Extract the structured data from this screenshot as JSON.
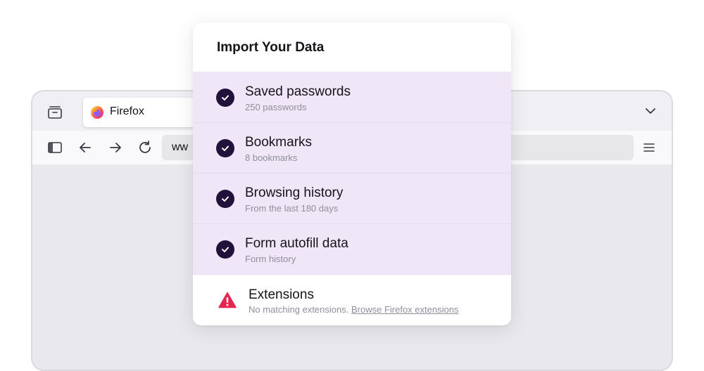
{
  "browser": {
    "tab_title": "Firefox",
    "url_text": "ww",
    "icons": {
      "tab_list": "tab-list-icon",
      "favicon": "firefox-logo-icon",
      "tabs_menu": "chevron-down-icon",
      "sidebar": "sidebar-icon",
      "back": "back-arrow-icon",
      "forward": "forward-arrow-icon",
      "reload": "reload-icon",
      "app_menu": "hamburger-menu-icon"
    }
  },
  "panel": {
    "title": "Import Your Data",
    "items": [
      {
        "label": "Saved passwords",
        "sub": "250 passwords",
        "checked": true
      },
      {
        "label": "Bookmarks",
        "sub": "8 bookmarks",
        "checked": true
      },
      {
        "label": "Browsing history",
        "sub": "From the last 180 days",
        "checked": true
      },
      {
        "label": "Form autofill data",
        "sub": "Form history",
        "checked": true
      }
    ],
    "extensions": {
      "label": "Extensions",
      "sub_text": "No matching extensions.",
      "link_text": "Browse Firefox extensions",
      "icon": "warning-triangle-icon"
    }
  },
  "colors": {
    "item_background": "#efe6f8",
    "check_fill": "#20123a",
    "warning": "#e22850"
  }
}
